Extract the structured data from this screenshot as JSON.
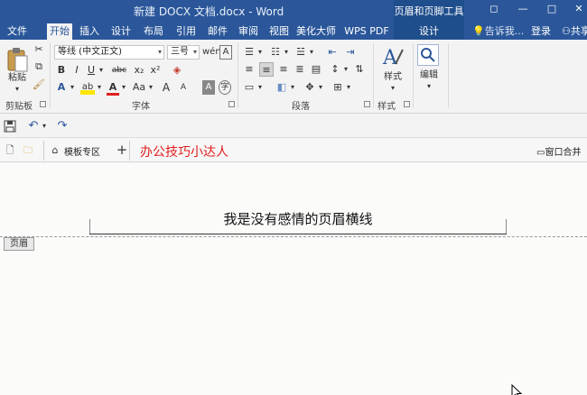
{
  "window": {
    "title": "新建 DOCX 文档.docx - Word",
    "context_tab_group": "页眉和页脚工具",
    "controls": {
      "restore": "◻",
      "minimize": "—",
      "maximize": "□",
      "close": "✕"
    }
  },
  "tabs": {
    "items": [
      "文件",
      "开始",
      "插入",
      "设计",
      "布局",
      "引用",
      "邮件",
      "审阅",
      "视图",
      "美化大师",
      "WPS PDF",
      "设计"
    ],
    "active": "开始",
    "tell_me": "告诉我...",
    "login": "登录",
    "share": "共享"
  },
  "ribbon": {
    "clipboard": {
      "label": "剪贴板",
      "paste": "粘贴"
    },
    "font": {
      "label": "字体",
      "font_name": "等线 (中文正文)",
      "font_size": "三号",
      "buttons": [
        "B",
        "I",
        "U",
        "abc",
        "x₂",
        "x²",
        "A",
        "A",
        "Aa",
        "A",
        "A"
      ]
    },
    "paragraph": {
      "label": "段落"
    },
    "styles": {
      "label": "样式",
      "button": "样式"
    },
    "editing": {
      "button": "编辑"
    }
  },
  "docbar": {
    "template_zone": "模板专区",
    "brand_text": "办公技巧小达人",
    "window_merge": "窗口合并"
  },
  "document": {
    "header_text": "我是没有感情的页眉横线",
    "header_tag": "页眉"
  },
  "colors": {
    "accent": "#2b579a",
    "context_band": "#1f4e8c",
    "brand_text": "#e11c1c"
  }
}
